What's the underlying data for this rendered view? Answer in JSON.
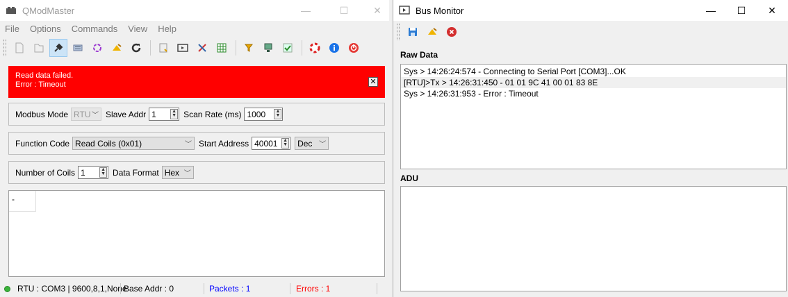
{
  "qmodmaster": {
    "title": "QModMaster",
    "menu": [
      "File",
      "Options",
      "Commands",
      "View",
      "Help"
    ],
    "toolbar_icons": [
      "new-file-icon",
      "open-file-icon",
      "connect-icon",
      "serial-port-icon",
      "reset-icon",
      "clear-icon",
      "refresh-icon",
      "log-icon",
      "bus-monitor-icon",
      "tools-icon",
      "grid-icon",
      "filter-icon",
      "network-icon",
      "check-icon",
      "help-icon",
      "info-icon",
      "exit-icon"
    ],
    "error": {
      "line1": "Read data failed.",
      "line2": "Error : Timeout",
      "close": "✕"
    },
    "modbus": {
      "mode_label": "Modbus Mode",
      "mode_value": "RTU",
      "slave_label": "Slave Addr",
      "slave_value": "1",
      "scan_label": "Scan Rate (ms)",
      "scan_value": "1000"
    },
    "function": {
      "code_label": "Function Code",
      "code_value": "Read Coils (0x01)",
      "start_label": "Start Address",
      "start_value": "40001",
      "format_value": "Dec"
    },
    "coils": {
      "count_label": "Number of Coils",
      "count_value": "1",
      "format_label": "Data Format",
      "format_value": "Hex"
    },
    "grid": {
      "cell0": "-"
    },
    "status": {
      "connection": "RTU : COM3 | 9600,8,1,None",
      "base_addr": "Base Addr : 0",
      "packets": "Packets : 1",
      "errors": "Errors : 1"
    },
    "colors": {
      "error_bg": "#ff0000",
      "packets_text": "#0000ff",
      "errors_text": "#ff0000",
      "status_ok": "#3bb33b"
    }
  },
  "bus_monitor": {
    "title": "Bus Monitor",
    "toolbar_icons": [
      "save-icon",
      "clear-icon",
      "exit-icon"
    ],
    "raw_label": "Raw Data",
    "raw_lines": [
      "Sys > 14:26:24:574 - Connecting to Serial Port [COM3]...OK",
      "[RTU]>Tx > 14:26:31:450 - 01  01  9C  41  00  01  83  8E",
      "Sys > 14:26:31:953 - Error : Timeout"
    ],
    "adu_label": "ADU"
  }
}
